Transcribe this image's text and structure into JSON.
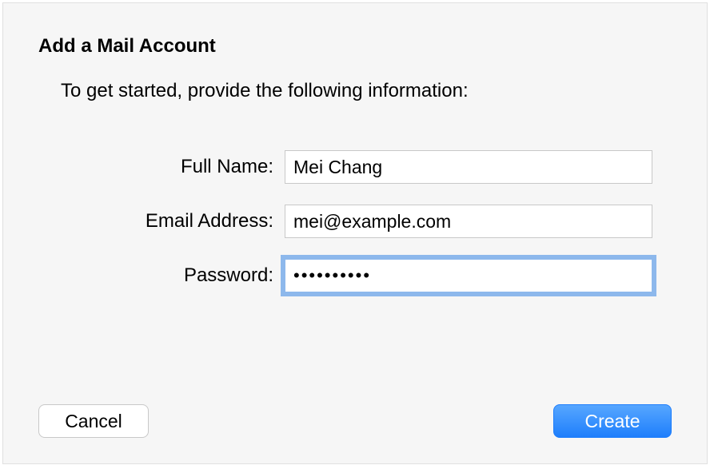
{
  "dialog": {
    "title": "Add a Mail Account",
    "subtitle": "To get started, provide the following information:"
  },
  "form": {
    "fullName": {
      "label": "Full Name:",
      "value": "Mei Chang"
    },
    "emailAddress": {
      "label": "Email Address:",
      "value": "mei@example.com"
    },
    "password": {
      "label": "Password:",
      "value": "••••••••••"
    }
  },
  "buttons": {
    "cancel": "Cancel",
    "create": "Create"
  }
}
